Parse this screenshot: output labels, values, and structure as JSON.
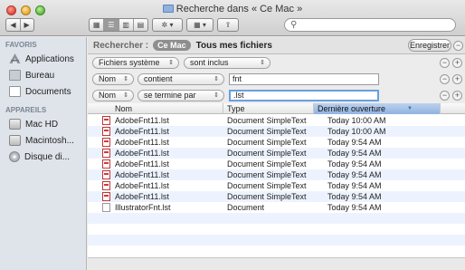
{
  "window": {
    "title": "Recherche dans « Ce Mac »"
  },
  "toolbar": {
    "back_icon": "back-arrow-icon",
    "forward_icon": "forward-arrow-icon",
    "view_icons": [
      "icon-view-icon",
      "list-view-icon",
      "column-view-icon",
      "coverflow-view-icon"
    ],
    "active_view": 1,
    "action_icon": "gear-icon",
    "arrange_icon": "arrange-icon",
    "share_icon": "share-icon",
    "search_value": ""
  },
  "sidebar": {
    "sections": [
      {
        "title": "FAVORIS",
        "items": [
          {
            "label": "Applications",
            "icon": "applications-icon"
          },
          {
            "label": "Bureau",
            "icon": "desktop-icon"
          },
          {
            "label": "Documents",
            "icon": "documents-icon"
          }
        ]
      },
      {
        "title": "APPAREILS",
        "items": [
          {
            "label": "Mac HD",
            "icon": "hard-drive-icon"
          },
          {
            "label": "Macintosh...",
            "icon": "hard-drive-icon"
          },
          {
            "label": "Disque di...",
            "icon": "disc-icon"
          }
        ]
      }
    ]
  },
  "searchbar": {
    "label": "Rechercher :",
    "scope_selected": "Ce Mac",
    "scope_other": "Tous mes fichiers",
    "save_label": "Enregistrer",
    "remove_symbol": "−"
  },
  "rules": [
    {
      "attr": "Fichiers système",
      "op": "sont inclus",
      "value": null
    },
    {
      "attr": "Nom",
      "op": "contient",
      "value": "fnt"
    },
    {
      "attr": "Nom",
      "op": "se termine par",
      "value": ".lst"
    }
  ],
  "rule_controls": {
    "minus": "−",
    "plus": "+"
  },
  "columns": {
    "name": "Nom",
    "type": "Type",
    "date": "Dernière ouverture",
    "sort_arrow": "▼"
  },
  "files": [
    {
      "name": "AdobeFnt11.lst",
      "type": "Document SimpleText",
      "date": "Today 10:00 AM",
      "icon": "simpletext-icon"
    },
    {
      "name": "AdobeFnt11.lst",
      "type": "Document SimpleText",
      "date": "Today 10:00 AM",
      "icon": "simpletext-icon"
    },
    {
      "name": "AdobeFnt11.lst",
      "type": "Document SimpleText",
      "date": "Today 9:54 AM",
      "icon": "simpletext-icon"
    },
    {
      "name": "AdobeFnt11.lst",
      "type": "Document SimpleText",
      "date": "Today 9:54 AM",
      "icon": "simpletext-icon"
    },
    {
      "name": "AdobeFnt11.lst",
      "type": "Document SimpleText",
      "date": "Today 9:54 AM",
      "icon": "simpletext-icon"
    },
    {
      "name": "AdobeFnt11.lst",
      "type": "Document SimpleText",
      "date": "Today 9:54 AM",
      "icon": "simpletext-icon"
    },
    {
      "name": "AdobeFnt11.lst",
      "type": "Document SimpleText",
      "date": "Today 9:54 AM",
      "icon": "simpletext-icon"
    },
    {
      "name": "AdobeFnt11.lst",
      "type": "Document SimpleText",
      "date": "Today 9:54 AM",
      "icon": "simpletext-icon"
    },
    {
      "name": "IllustratorFnt.lst",
      "type": "Document",
      "date": "Today 9:54 AM",
      "icon": "document-icon"
    }
  ],
  "colors": {
    "row_alt": "#edf3fe",
    "sorted_header": "#8fb2e2",
    "sidebar_bg": "#dfe4ea",
    "focus_ring": "#6a9ee0"
  }
}
